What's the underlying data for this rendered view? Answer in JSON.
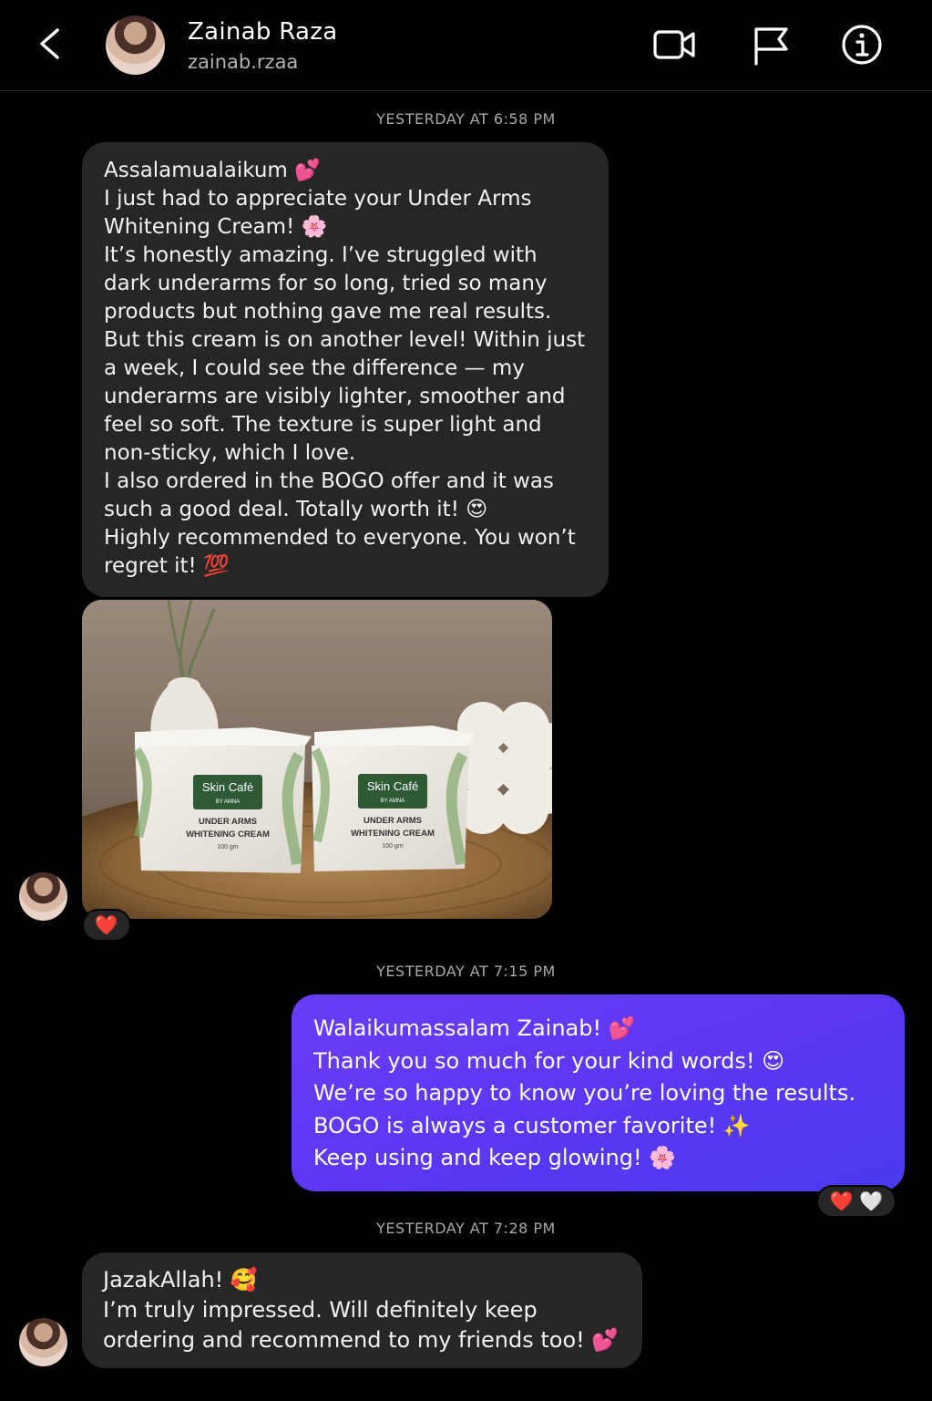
{
  "header": {
    "name": "Zainab Raza",
    "handle": "zainab.rzaa",
    "icons": [
      "back-icon",
      "video-call-icon",
      "flag-icon",
      "info-icon"
    ]
  },
  "messages": {
    "ts1": "YESTERDAY AT 6:58 PM",
    "m1": "Assalamualaikum 💕\nI just had to appreciate your Under Arms Whitening Cream! 🌸\nIt’s honestly amazing. I’ve struggled with dark underarms for so long, tried so many products but nothing gave me real results. But this cream is on another level! Within just a week, I could see the difference — my underarms are visibly lighter, smoother and feel so soft. The texture is super light and non-sticky, which I love.\nI also ordered in the BOGO offer and it was such a good deal. Totally worth it! 😍\nHighly recommended to everyone. You won’t regret it! 💯",
    "photo": {
      "box_brand": "Skin Café",
      "box_sub": "BY AMNA",
      "box_title_1": "UNDER ARMS",
      "box_title_2": "WHITENING CREAM",
      "box_weight": "100 gm"
    },
    "reaction1": "❤️",
    "ts2": "YESTERDAY AT 7:15 PM",
    "m2": "Walaikumassalam Zainab! 💕\nThank you so much for your kind words! 😍\nWe’re so happy to know you’re loving the results.\nBOGO is always a customer favorite! ✨\nKeep using and keep glowing! 🌸",
    "reaction2a": "❤️",
    "reaction2b": "🤍",
    "ts3": "YESTERDAY AT 7:28 PM",
    "m3": "JazakAllah! 🥰\nI’m truly impressed. Will definitely keep ordering and recommend to my friends too! 💕"
  },
  "colors": {
    "background": "#000000",
    "incoming_bubble": "#262626",
    "outgoing_bubble": "#5b36f3"
  }
}
